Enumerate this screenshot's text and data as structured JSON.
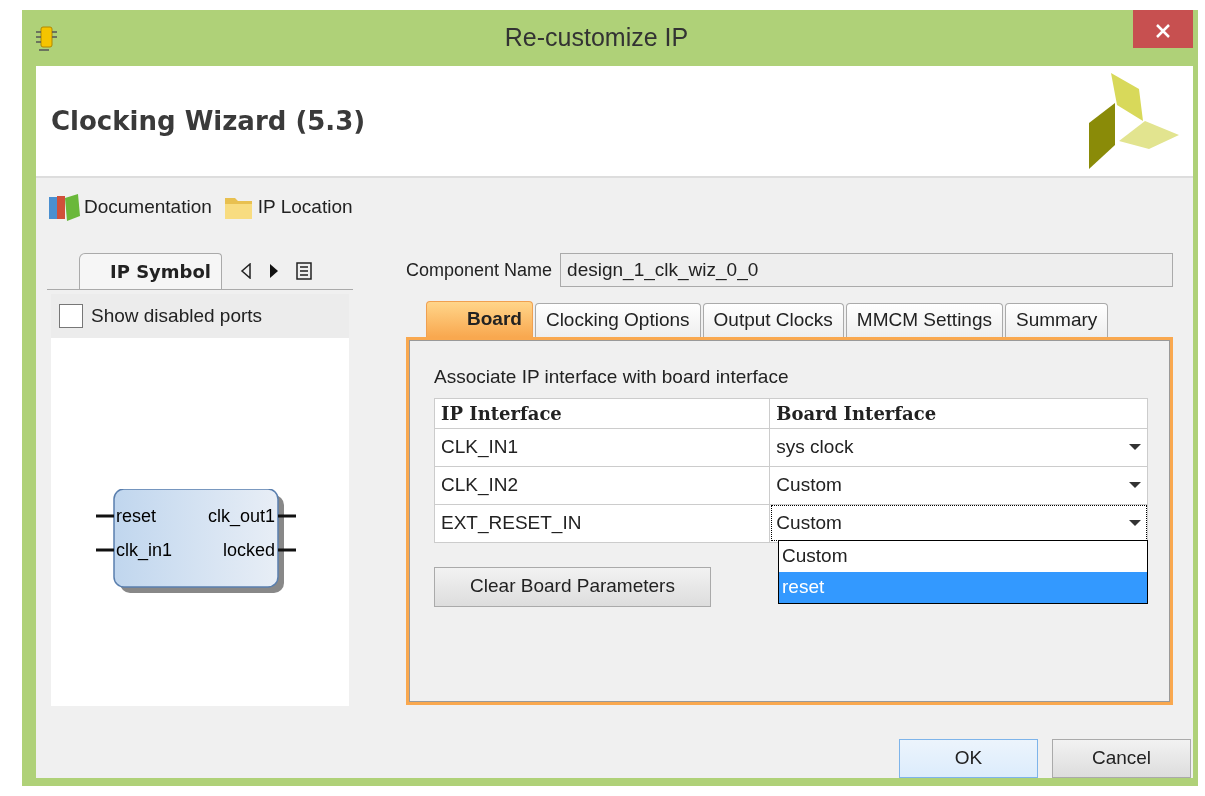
{
  "window": {
    "title": "Re-customize IP"
  },
  "header": {
    "title": "Clocking Wizard (5.3)"
  },
  "toolbar": [
    {
      "label": "Documentation",
      "kind": "books"
    },
    {
      "label": "IP Location",
      "kind": "folder"
    }
  ],
  "left_panel": {
    "tabs": [
      {
        "label": "IP Symbol",
        "selected": true
      }
    ],
    "show_disabled_ports": {
      "label": "Show disabled ports",
      "checked": false
    },
    "symbol": {
      "inputs": [
        "reset",
        "clk_in1"
      ],
      "outputs": [
        "clk_out1",
        "locked"
      ]
    }
  },
  "component_name": {
    "label": "Component Name",
    "value": "design_1_clk_wiz_0_0"
  },
  "tabs": [
    {
      "label": "Board",
      "selected": true
    },
    {
      "label": "Clocking Options",
      "selected": false
    },
    {
      "label": "Output Clocks",
      "selected": false
    },
    {
      "label": "MMCM Settings",
      "selected": false
    },
    {
      "label": "Summary",
      "selected": false
    }
  ],
  "board": {
    "caption": "Associate IP interface with board interface",
    "columns": [
      "IP Interface",
      "Board Interface"
    ],
    "rows": [
      {
        "ip": "CLK_IN1",
        "board": "sys clock",
        "focused": false
      },
      {
        "ip": "CLK_IN2",
        "board": "Custom",
        "focused": false
      },
      {
        "ip": "EXT_RESET_IN",
        "board": "Custom",
        "focused": true
      }
    ],
    "dropdown": {
      "options": [
        {
          "label": "Custom",
          "selected": false
        },
        {
          "label": "reset",
          "selected": true
        }
      ]
    },
    "clear_button": "Clear Board Parameters"
  },
  "buttons": [
    {
      "label": "OK",
      "kind": "default"
    },
    {
      "label": "Cancel",
      "kind": "normal"
    }
  ]
}
